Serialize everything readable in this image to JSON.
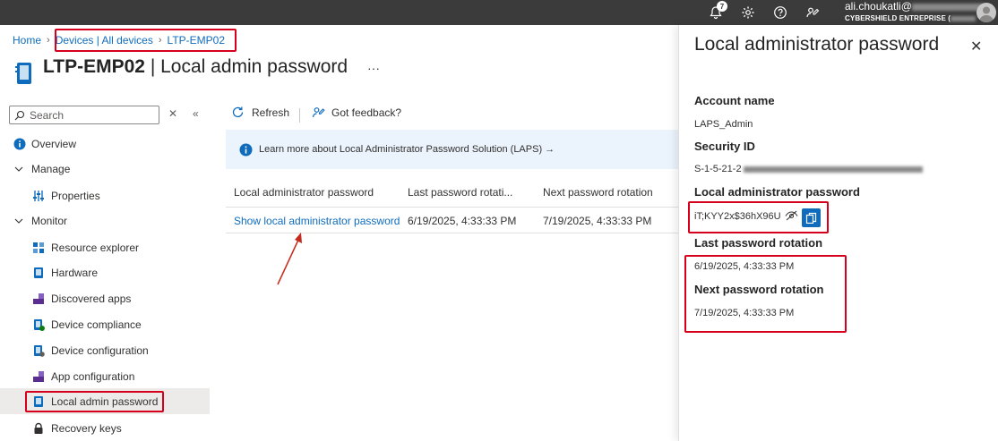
{
  "topbar": {
    "notification_count": "7",
    "user_name": "ali.choukatli@",
    "tenant_name": "CYBERSHIELD ENTREPRISE ("
  },
  "breadcrumb": {
    "home": "Home",
    "devices": "Devices | All devices",
    "device": "LTP-EMP02"
  },
  "page": {
    "device_name": "LTP-EMP02",
    "section": "| Local admin password",
    "more": "···"
  },
  "nav": {
    "search_placeholder": "Search",
    "overview": "Overview",
    "manage": "Manage",
    "properties": "Properties",
    "monitor": "Monitor",
    "resource_explorer": "Resource explorer",
    "hardware": "Hardware",
    "discovered_apps": "Discovered apps",
    "device_compliance": "Device compliance",
    "device_configuration": "Device configuration",
    "app_configuration": "App configuration",
    "local_admin_password": "Local admin password",
    "recovery_keys": "Recovery keys"
  },
  "toolbar": {
    "refresh": "Refresh",
    "feedback": "Got feedback?"
  },
  "banner": {
    "text": "Learn more about Local Administrator Password Solution (LAPS)  →"
  },
  "table": {
    "headers": [
      "Local administrator password",
      "Last password rotati...",
      "Next password rotation"
    ],
    "row": {
      "show_link": "Show local administrator password",
      "last_rotation": "6/19/2025, 4:33:33 PM",
      "next_rotation": "7/19/2025, 4:33:33 PM"
    }
  },
  "panel": {
    "title": "Local administrator password",
    "account_name_label": "Account name",
    "account_name": "LAPS_Admin",
    "security_id_label": "Security ID",
    "security_id": "S-1-5-21-2",
    "password_label": "Local administrator password",
    "password": "iT;KYY2x$36hX96U",
    "last_rotation_label": "Last password rotation",
    "last_rotation": "6/19/2025, 4:33:33 PM",
    "next_rotation_label": "Next password rotation",
    "next_rotation": "7/19/2025, 4:33:33 PM"
  },
  "colors": {
    "accent": "#0f6cbd",
    "highlight": "#d6001c",
    "topbar": "#3b3b3b"
  }
}
